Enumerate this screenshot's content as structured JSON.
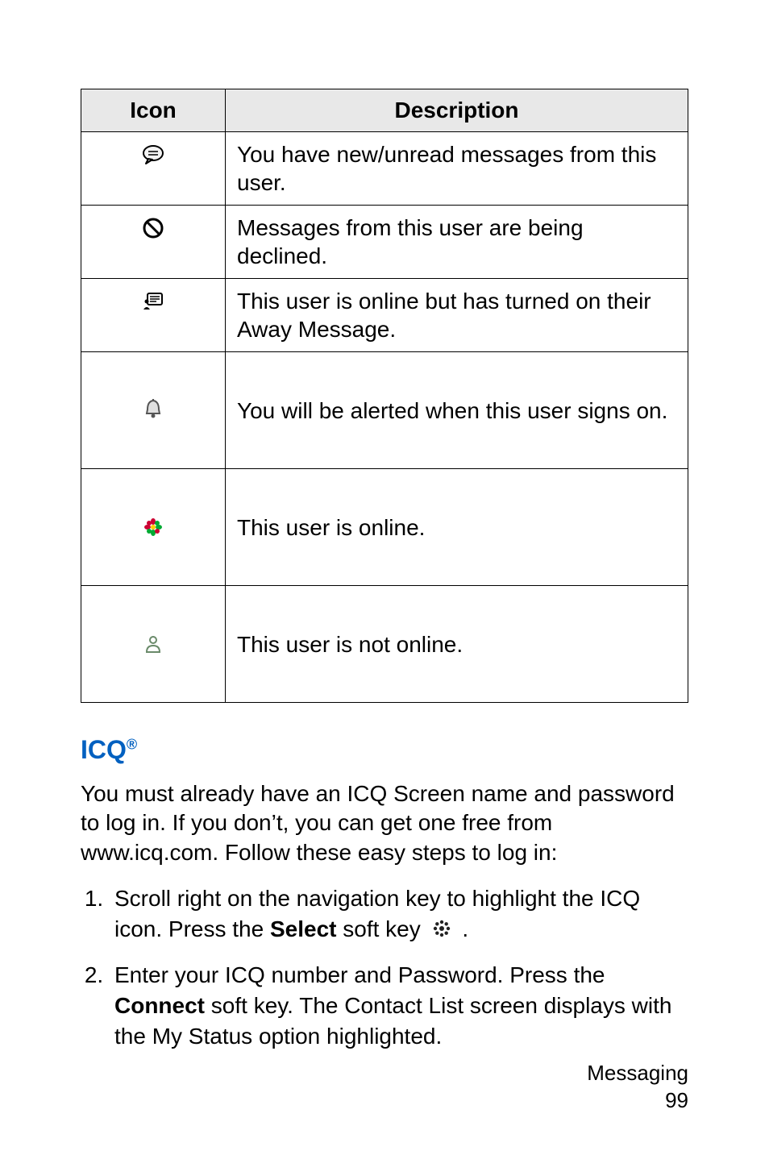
{
  "table": {
    "header_icon": "Icon",
    "header_desc": "Description",
    "rows": [
      {
        "desc": "You have new/unread messages from this user."
      },
      {
        "desc": "Messages from this user are being declined."
      },
      {
        "desc": "This user is online but has turned on their Away Message."
      },
      {
        "desc": "You will be alerted when this user signs on."
      },
      {
        "desc": "This user is online."
      },
      {
        "desc": "This user is not online."
      }
    ]
  },
  "section_heading": "ICQ",
  "section_heading_sup": "®",
  "intro_paragraph": "You must already have an ICQ Screen name and password to log in. If you don’t, you can get one free from www.icq.com. Follow these easy steps to log in:",
  "steps": {
    "s1_a": "Scroll right on the navigation key to highlight the ICQ icon. Press the ",
    "s1_bold": "Select",
    "s1_b": " soft key ",
    "s1_c": ".",
    "s2_a": "Enter your ICQ number and Password. Press the ",
    "s2_bold": "Connect",
    "s2_b": " soft key. The Contact List screen displays with the My Status option highlighted."
  },
  "footer": {
    "line1": "Messaging",
    "line2": "99"
  }
}
